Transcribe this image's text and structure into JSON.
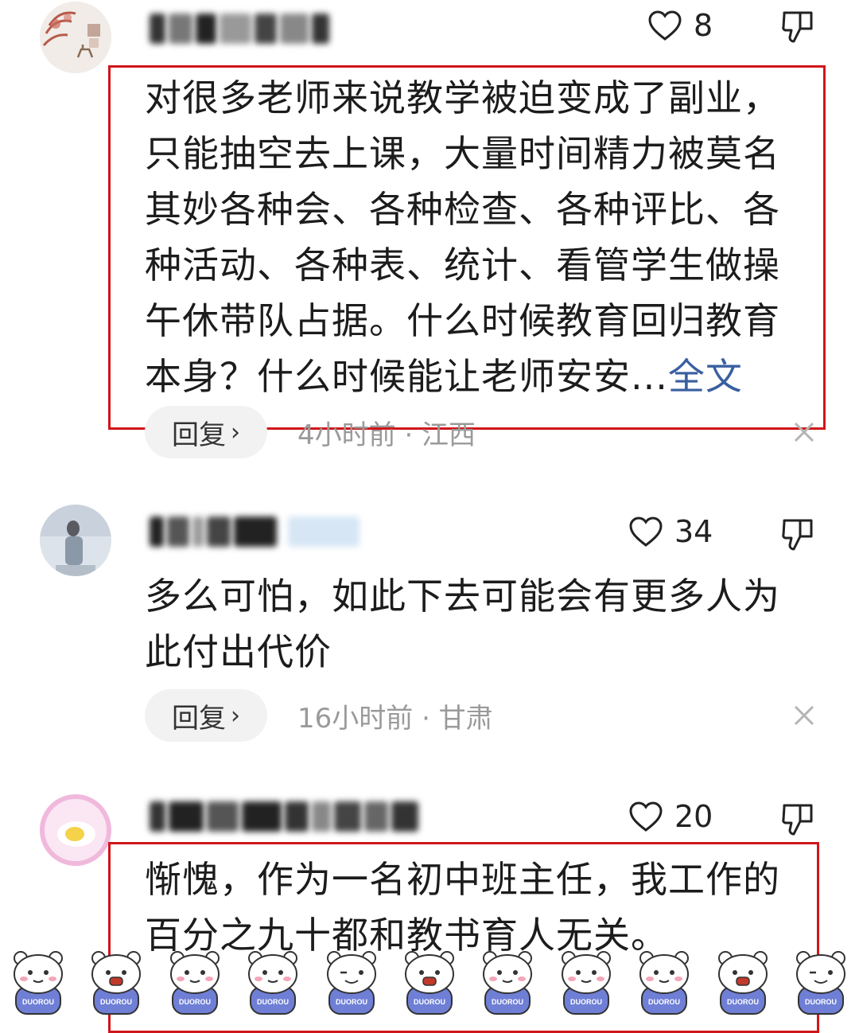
{
  "comments": [
    {
      "like_count": "8",
      "body": "对很多老师来说教学被迫变成了副业，只能抽空去上课，大量时间精力被莫名其妙各种会、各种检查、各种评比、各种活动、各种表、统计、看管学生做操午休带队占据。什么时候教育回归教育本身？什么时候能让老师安安...",
      "more_label": "全文",
      "reply_label": "回复",
      "meta": "4小时前 · 江西"
    },
    {
      "like_count": "34",
      "body": "多么可怕，如此下去可能会有更多人为此付出代价",
      "reply_label": "回复",
      "meta": "16小时前 · 甘肃"
    },
    {
      "like_count": "20",
      "body": "惭愧，作为一名初中班主任，我工作的百分之九十都和教书育人无关。"
    }
  ],
  "sticker_text": "DUOROU",
  "colors": {
    "highlight": "#d0161a",
    "link": "#3a5fa0",
    "meta": "#9a9a9a"
  }
}
